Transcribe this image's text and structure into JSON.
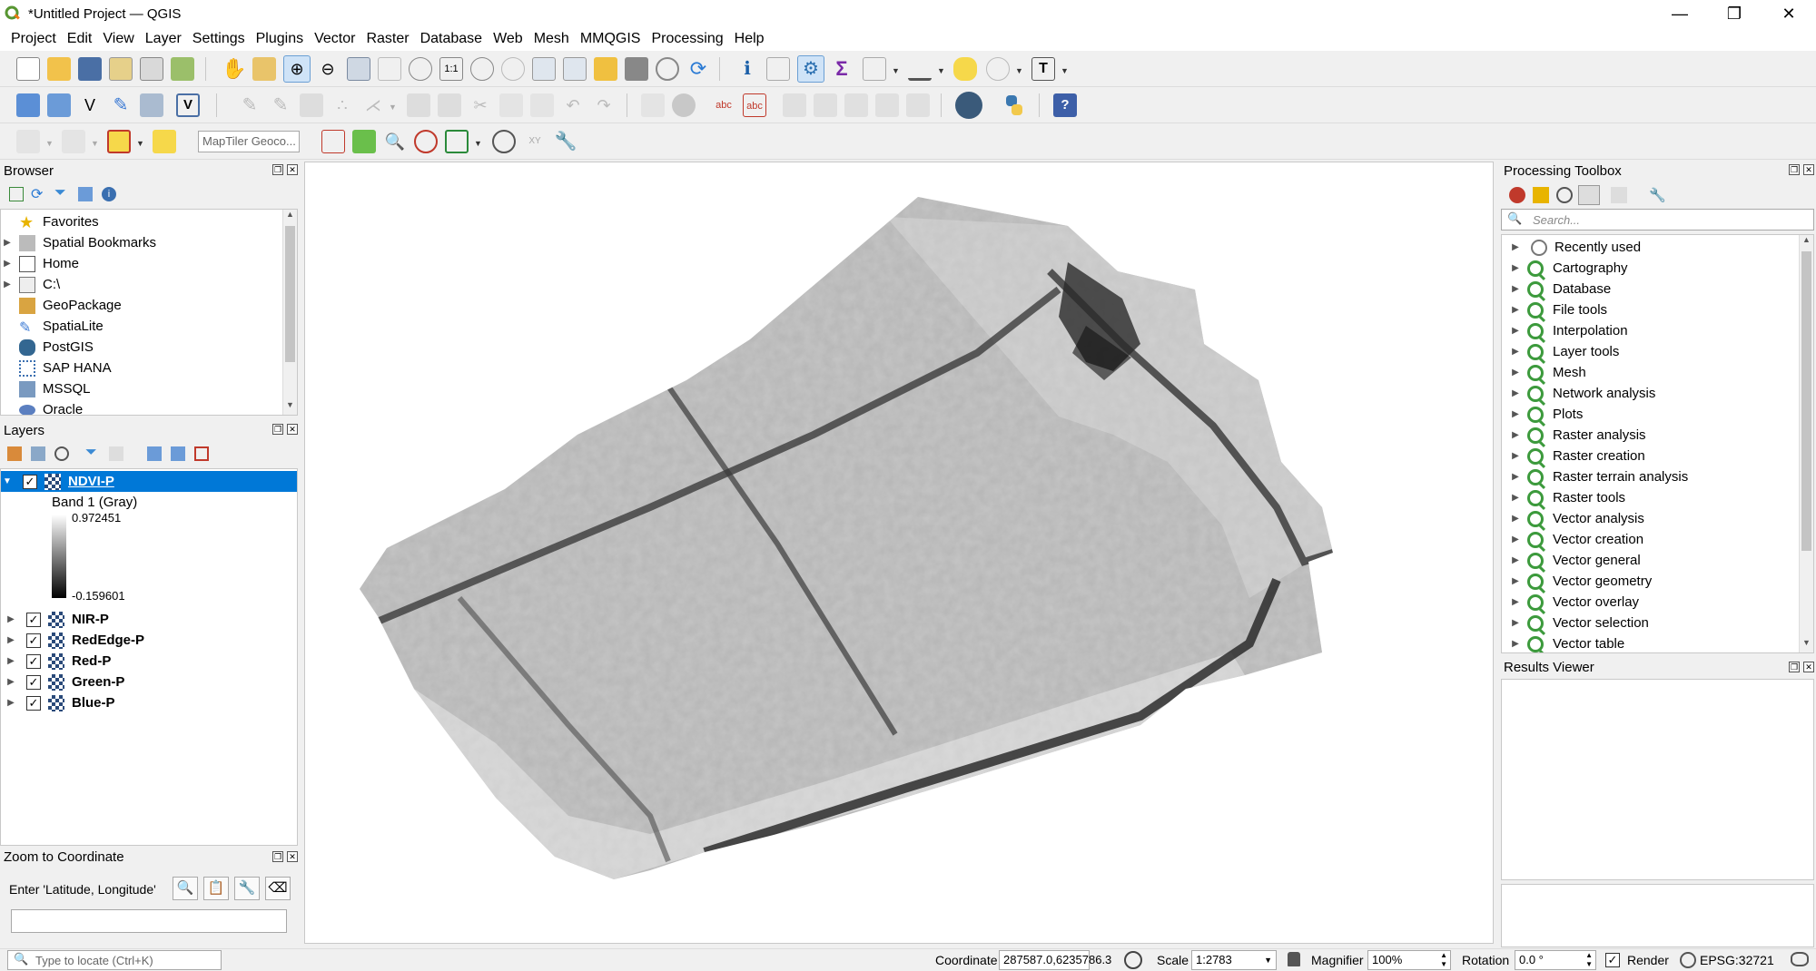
{
  "window": {
    "title": "*Untitled Project — QGIS",
    "minimize": "—",
    "maximize": "❐",
    "close": "✕"
  },
  "menu": [
    "Project",
    "Edit",
    "View",
    "Layer",
    "Settings",
    "Plugins",
    "Vector",
    "Raster",
    "Database",
    "Web",
    "Mesh",
    "MMQGIS",
    "Processing",
    "Help"
  ],
  "toolbar3": {
    "geocoder_placeholder": "MapTiler Geoco..."
  },
  "browser": {
    "title": "Browser",
    "items": [
      {
        "label": "Favorites",
        "icon": "star-icon",
        "expandable": false
      },
      {
        "label": "Spatial Bookmarks",
        "icon": "bookmark-icon",
        "expandable": true
      },
      {
        "label": "Home",
        "icon": "home-icon",
        "expandable": true
      },
      {
        "label": "C:\\",
        "icon": "drive-icon",
        "expandable": true
      },
      {
        "label": "GeoPackage",
        "icon": "geopackage-icon",
        "expandable": false
      },
      {
        "label": "SpatiaLite",
        "icon": "spatialite-icon",
        "expandable": false
      },
      {
        "label": "PostGIS",
        "icon": "postgis-icon",
        "expandable": false
      },
      {
        "label": "SAP HANA",
        "icon": "hana-icon",
        "expandable": false
      },
      {
        "label": "MSSQL",
        "icon": "mssql-icon",
        "expandable": false
      },
      {
        "label": "Oracle",
        "icon": "oracle-icon",
        "expandable": false
      }
    ]
  },
  "layers": {
    "title": "Layers",
    "active": {
      "name": "NDVI-P",
      "band": "Band 1 (Gray)",
      "max": "0.972451",
      "min": "-0.159601"
    },
    "others": [
      "NIR-P",
      "RedEdge-P",
      "Red-P",
      "Green-P",
      "Blue-P"
    ]
  },
  "zoom_to_coordinate": {
    "title": "Zoom to Coordinate",
    "label": "Enter 'Latitude, Longitude'"
  },
  "locator": {
    "placeholder": "Type to locate (Ctrl+K)"
  },
  "processing": {
    "title": "Processing Toolbox",
    "search_placeholder": "Search...",
    "items": [
      "Recently used",
      "Cartography",
      "Database",
      "File tools",
      "Interpolation",
      "Layer tools",
      "Mesh",
      "Network analysis",
      "Plots",
      "Raster analysis",
      "Raster creation",
      "Raster terrain analysis",
      "Raster tools",
      "Vector analysis",
      "Vector creation",
      "Vector general",
      "Vector geometry",
      "Vector overlay",
      "Vector selection",
      "Vector table"
    ]
  },
  "results": {
    "title": "Results Viewer"
  },
  "status": {
    "coordinate_label": "Coordinate",
    "coordinate": "287587.0,6235786.3",
    "scale_label": "Scale",
    "scale": "1:2783",
    "magnifier_label": "Magnifier",
    "magnifier": "100%",
    "rotation_label": "Rotation",
    "rotation": "0.0 °",
    "render_label": "Render",
    "crs": "EPSG:32721"
  }
}
